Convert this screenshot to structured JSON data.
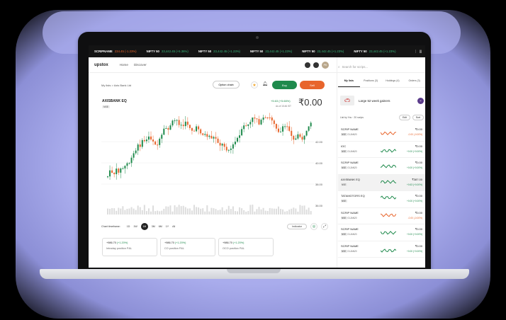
{
  "ticker": [
    {
      "name": "SCRIPNAME",
      "val": "234.45",
      "chg": "(-1.23%)",
      "dir": "neg"
    },
    {
      "name": "NIFTY 50",
      "val": "23,442.45",
      "chg": "(+5.36%)",
      "dir": "pos"
    },
    {
      "name": "NIFTY 50",
      "val": "23,442.45",
      "chg": "(+1.23%)",
      "dir": "pos"
    },
    {
      "name": "NIFTY 50",
      "val": "23,442.45",
      "chg": "(+1.23%)",
      "dir": "pos"
    },
    {
      "name": "NIFTY 50",
      "val": "23,442.45",
      "chg": "(+1.23%)",
      "dir": "pos"
    },
    {
      "name": "NIFTY 50",
      "val": "23,442.45",
      "chg": "(+1.23%)",
      "dir": "pos"
    }
  ],
  "nav": {
    "logo": "upstox",
    "home": "Home",
    "discover": "Discover",
    "avatar": "PK"
  },
  "search": {
    "placeholder": "Search for scrips..."
  },
  "breadcrumb": {
    "a": "My lists",
    "sep": ">",
    "b": "Axis Bank Ltd"
  },
  "actions": {
    "option_chain": "Option chain",
    "buy": "Buy",
    "sell": "Sell"
  },
  "scrip": {
    "symbol": "AXISBANK EQ",
    "exchange": "NSE",
    "change": "+5.63 (+5.66%)",
    "as_of": "As of 15:46 IST",
    "price": "₹0.00"
  },
  "yaxis": [
    "42.00",
    "40.00",
    "38.00",
    "36.00"
  ],
  "timeframes": {
    "label": "Chart timeframe:",
    "items": [
      "1D",
      "1W",
      "1M",
      "3M",
      "6M",
      "1Y",
      "All"
    ],
    "active": "1M",
    "indicator": "Indicator"
  },
  "pnl": [
    {
      "value": "+986.70",
      "pct": "(+1.20%)",
      "label": "Intraday position P&L"
    },
    {
      "value": "+986.70",
      "pct": "(+1.20%)",
      "label": "CO position P&L"
    },
    {
      "value": "+986.70",
      "pct": "(+1.20%)",
      "label": "OCO position P&L"
    }
  ],
  "tabs": [
    "My lists",
    "Positions (3)",
    "Holdings (4)",
    "Orders (3)"
  ],
  "watchlist": {
    "name": "Large 52 week gainers",
    "header": "List by You · 20 scrips",
    "edit": "Edit",
    "sort": "Sort"
  },
  "rows": [
    {
      "name": "SCRIP NAME",
      "ex": "NSE",
      "exp": "01JAN20",
      "price": "₹0.00",
      "chg": "-0.00 (-0.00%)",
      "dir": "neg"
    },
    {
      "name": "IOC",
      "ex": "NSE",
      "exp": "01JAN20",
      "price": "₹0.00",
      "chg": "+0.00 (+0.00%)",
      "dir": "pos"
    },
    {
      "name": "SCRIP NAME",
      "ex": "NSE",
      "exp": "01JAN20",
      "price": "₹0.00",
      "chg": "+0.00 (+0.00%)",
      "dir": "pos"
    },
    {
      "name": "AXISBANK EQ",
      "ex": "NSE",
      "exp": "",
      "price": "₹387.00",
      "chg": "+0.63 (+0.00%)",
      "dir": "pos"
    },
    {
      "name": "TATAMOTORS EQ",
      "ex": "NSE",
      "exp": "",
      "price": "₹0.00",
      "chg": "+0.00 (+0.00%)",
      "dir": "pos"
    },
    {
      "name": "SCRIP NAME",
      "ex": "NSE",
      "exp": "01JAN20",
      "price": "₹0.00",
      "chg": "-0.00 (-0.00%)",
      "dir": "neg"
    },
    {
      "name": "SCRIP NAME",
      "ex": "NSE",
      "exp": "01JAN20",
      "price": "₹0.00",
      "chg": "+0.00 (+0.00%)",
      "dir": "pos"
    },
    {
      "name": "SCRIP NAME",
      "ex": "NSE",
      "exp": "01JAN20",
      "price": "₹0.00",
      "chg": "+0.00 (+0.00%)",
      "dir": "pos"
    }
  ],
  "colors": {
    "up": "#1f8a4c",
    "down": "#e8652c",
    "accent": "#5a3b8a"
  }
}
